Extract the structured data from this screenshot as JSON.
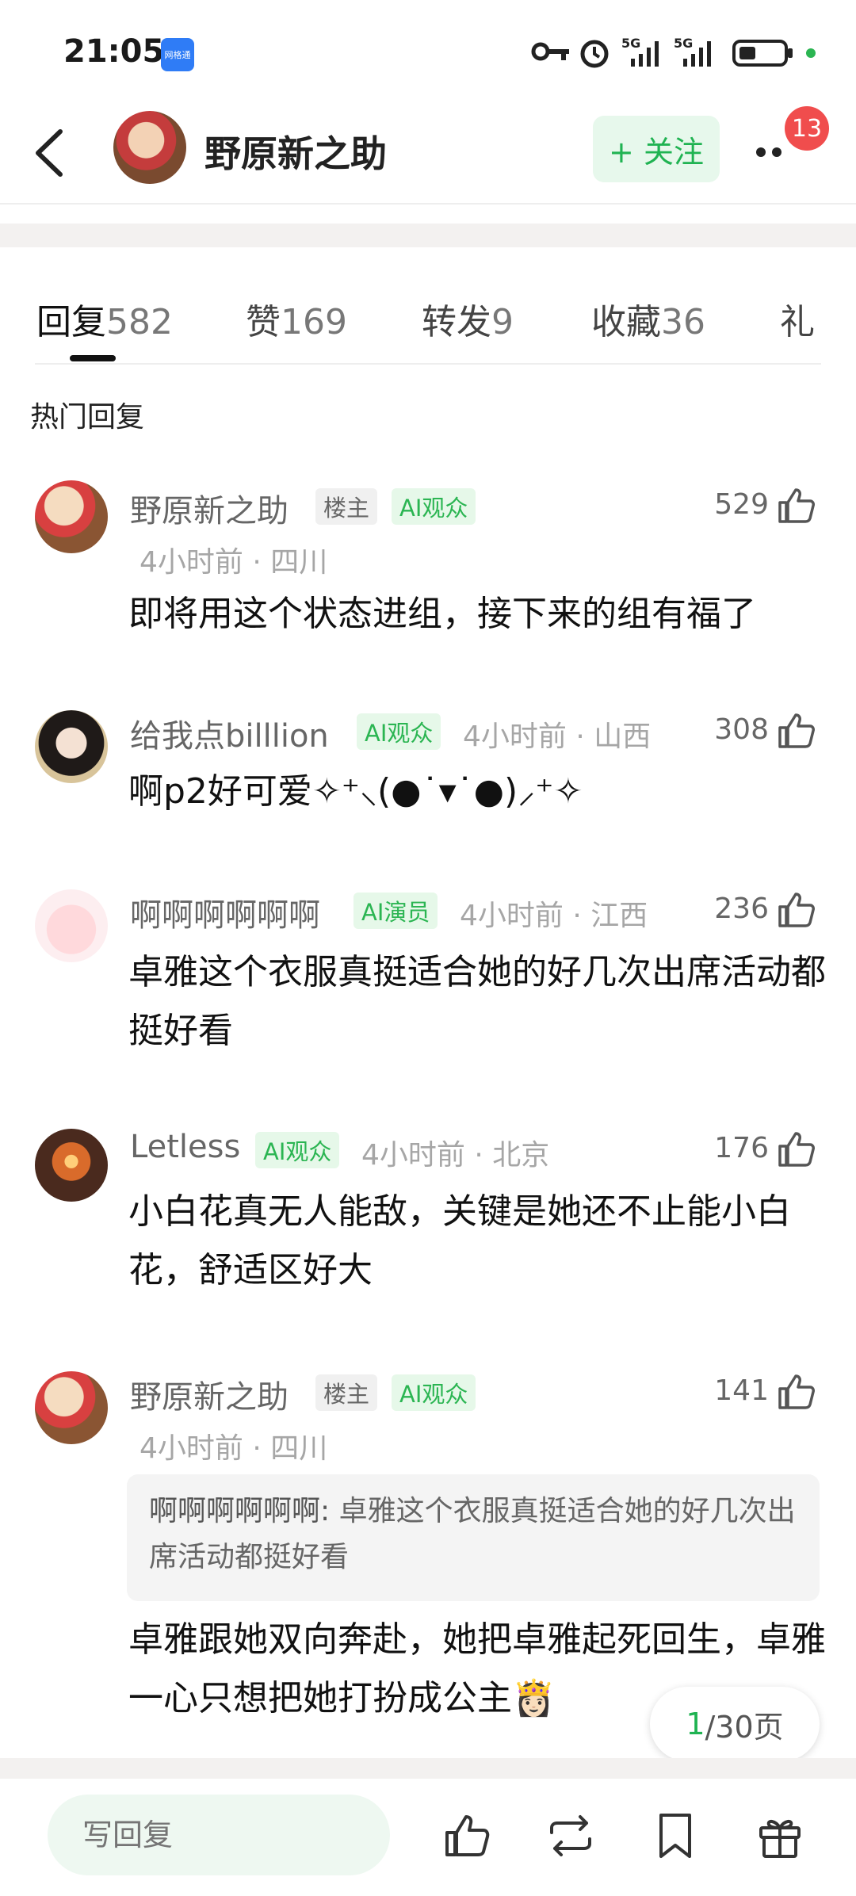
{
  "status_bar": {
    "time": "21:05",
    "app_badge": "网格通",
    "battery_dot_color": "#2bb552"
  },
  "header": {
    "user_name": "野原新之助",
    "follow_label": "+ 关注",
    "notification_count": "13"
  },
  "tabs": [
    {
      "label": "回复",
      "count": "582"
    },
    {
      "label": "赞",
      "count": "169"
    },
    {
      "label": "转发",
      "count": "9"
    },
    {
      "label": "收藏",
      "count": "36"
    },
    {
      "label": "礼",
      "count": ""
    }
  ],
  "section_title": "热门回复",
  "comments": [
    {
      "name": "野原新之助",
      "tags": [
        "楼主",
        "AI观众"
      ],
      "meta": "4小时前 · 四川",
      "likes": "529",
      "text": "即将用这个状态进组，接下来的组有福了"
    },
    {
      "name": "给我点billlion",
      "tags": [
        "AI观众"
      ],
      "meta": "4小时前 · 山西",
      "likes": "308",
      "text": "啊p2好可爱✧⁺⸜(●˙▾˙●)⸝⁺✧"
    },
    {
      "name": "啊啊啊啊啊啊",
      "tags": [
        "AI演员"
      ],
      "meta": "4小时前 · 江西",
      "likes": "236",
      "text": "卓雅这个衣服真挺适合她的好几次出席活动都挺好看"
    },
    {
      "name": "Letless",
      "tags": [
        "AI观众"
      ],
      "meta": "4小时前 · 北京",
      "likes": "176",
      "text": "小白花真无人能敌，关键是她还不止能小白花，舒适区好大"
    },
    {
      "name": "野原新之助",
      "tags": [
        "楼主",
        "AI观众"
      ],
      "meta": "4小时前 · 四川",
      "likes": "141",
      "quote_author": "啊啊啊啊啊啊:",
      "quote_text": "卓雅这个衣服真挺适合她的好几次出席活动都挺好看",
      "text": "卓雅跟她双向奔赴，她把卓雅起死回生，卓雅一心只想把她打扮成公主👸🏻"
    }
  ],
  "pagination": {
    "current": "1",
    "rest": "/30页"
  },
  "bottom_bar": {
    "reply_placeholder": "写回复",
    "accent_color": "#20b352"
  }
}
